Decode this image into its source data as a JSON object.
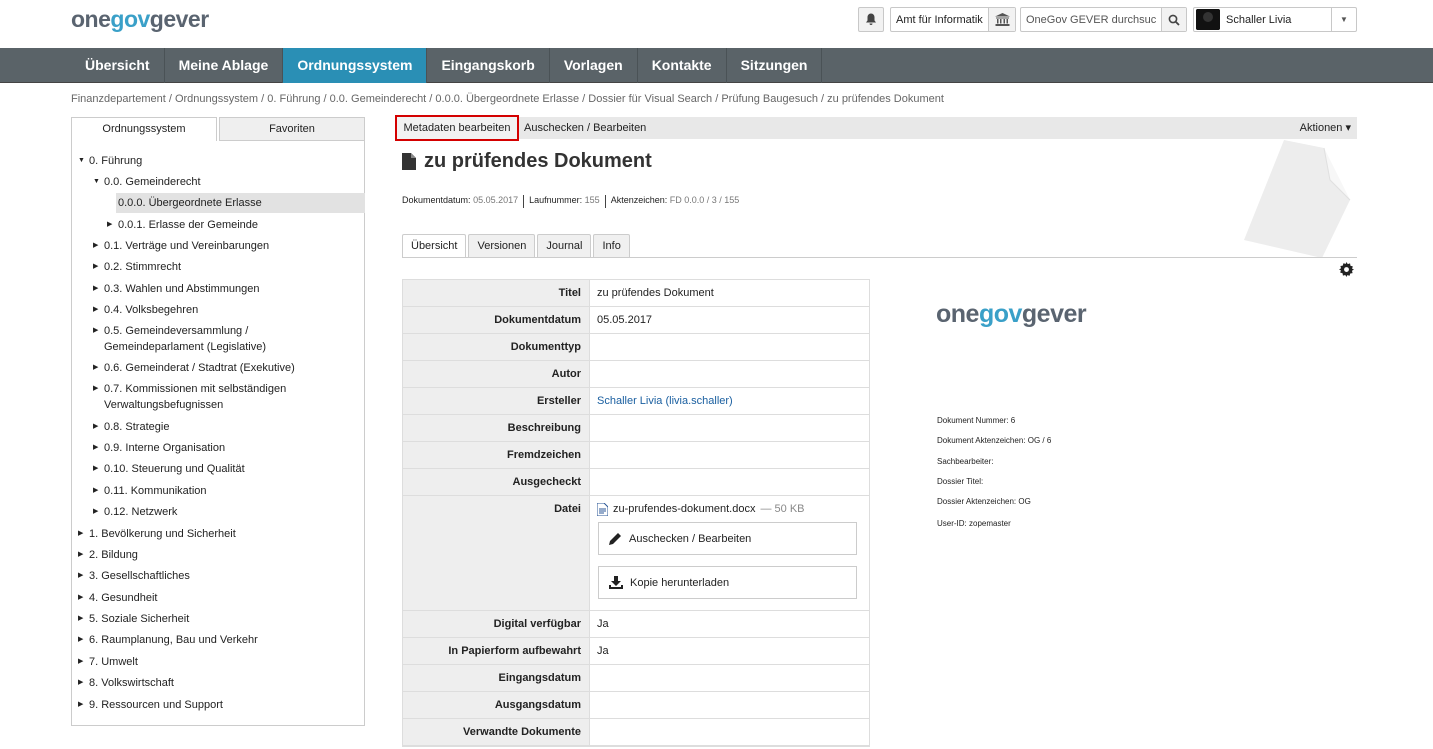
{
  "header": {
    "logo": {
      "part1": "one",
      "part2": "gov",
      "part3": "gever"
    },
    "org_name": "Amt für Informatik",
    "search_value": "OneGov GEVER durchsuc",
    "user_name": "Schaller Livia"
  },
  "nav": {
    "items": [
      "Übersicht",
      "Meine Ablage",
      "Ordnungssystem",
      "Eingangskorb",
      "Vorlagen",
      "Kontakte",
      "Sitzungen"
    ],
    "active_index": 2
  },
  "breadcrumb": "Finanzdepartement / Ordnungssystem / 0. Führung / 0.0. Gemeinderecht / 0.0.0. Übergeordnete Erlasse / Dossier für Visual Search / Prüfung Baugesuch / zu prüfendes Dokument",
  "sidebar": {
    "tabs": [
      "Ordnungssystem",
      "Favoriten"
    ],
    "tree": [
      {
        "label": "0. Führung",
        "expanded": true
      },
      {
        "label": "0.0. Gemeinderecht",
        "expanded": true
      },
      {
        "label": "0.0.0. Übergeordnete Erlasse",
        "selected": true
      },
      {
        "label": "0.0.1. Erlasse der Gemeinde"
      },
      {
        "label": "0.1. Verträge und Vereinbarungen"
      },
      {
        "label": "0.2. Stimmrecht"
      },
      {
        "label": "0.3. Wahlen und Abstimmungen"
      },
      {
        "label": "0.4. Volksbegehren"
      },
      {
        "label": "0.5. Gemeindeversammlung / Gemeindeparlament (Legislative)"
      },
      {
        "label": "0.6. Gemeinderat / Stadtrat (Exekutive)"
      },
      {
        "label": "0.7. Kommissionen mit selbständigen Verwaltungsbefugnissen"
      },
      {
        "label": "0.8. Strategie"
      },
      {
        "label": "0.9. Interne Organisation"
      },
      {
        "label": "0.10. Steuerung und Qualität"
      },
      {
        "label": "0.11. Kommunikation"
      },
      {
        "label": "0.12. Netzwerk"
      },
      {
        "label": "1. Bevölkerung und Sicherheit"
      },
      {
        "label": "2. Bildung"
      },
      {
        "label": "3. Gesellschaftliches"
      },
      {
        "label": "4. Gesundheit"
      },
      {
        "label": "5. Soziale Sicherheit"
      },
      {
        "label": "6. Raumplanung, Bau und Verkehr"
      },
      {
        "label": "7. Umwelt"
      },
      {
        "label": "8. Volkswirtschaft"
      },
      {
        "label": "9. Ressourcen und Support"
      }
    ]
  },
  "toolbar": {
    "edit_metadata": "Metadaten bearbeiten",
    "checkout": "Auschecken / Bearbeiten",
    "actions": "Aktionen ▾"
  },
  "document": {
    "title": "zu prüfendes Dokument",
    "meta": {
      "date_label": "Dokumentdatum:",
      "date": "05.05.2017",
      "seq_label": "Laufnummer:",
      "seq": "155",
      "ref_label": "Aktenzeichen:",
      "ref": "FD 0.0.0 / 3 / 155"
    },
    "tabs": [
      "Übersicht",
      "Versionen",
      "Journal",
      "Info"
    ],
    "fields": [
      {
        "label": "Titel",
        "value": "zu prüfendes Dokument"
      },
      {
        "label": "Dokumentdatum",
        "value": "05.05.2017"
      },
      {
        "label": "Dokumenttyp",
        "value": ""
      },
      {
        "label": "Autor",
        "value": ""
      },
      {
        "label": "Ersteller",
        "value": "Schaller Livia (livia.schaller)"
      },
      {
        "label": "Beschreibung",
        "value": ""
      },
      {
        "label": "Fremdzeichen",
        "value": ""
      },
      {
        "label": "Ausgecheckt",
        "value": ""
      },
      {
        "label": "Datei",
        "value": ""
      },
      {
        "label": "Digital verfügbar",
        "value": "Ja"
      },
      {
        "label": "In Papierform aufbewahrt",
        "value": "Ja"
      },
      {
        "label": "Eingangsdatum",
        "value": ""
      },
      {
        "label": "Ausgangsdatum",
        "value": ""
      },
      {
        "label": "Verwandte Dokumente",
        "value": ""
      }
    ],
    "file": {
      "name": "zu-prufendes-dokument.docx",
      "size": "— 50 KB",
      "checkout_button": "Auschecken / Bearbeiten",
      "download_button": "Kopie herunterladen"
    }
  },
  "preview": {
    "logo": {
      "part1": "one",
      "part2": "gov",
      "part3": "gever"
    },
    "lines": [
      "Dokument Nummer: 6",
      "Dokument Aktenzeichen: OG / 6",
      "Sachbearbeiter:",
      "Dossier Titel:",
      "Dossier Aktenzeichen: OG",
      "User-ID: zopemaster"
    ]
  },
  "colors": {
    "nav_bg": "#5a6368",
    "nav_active": "#2a8fb5",
    "highlight_border": "#d40000",
    "link": "#1a5fa0"
  }
}
